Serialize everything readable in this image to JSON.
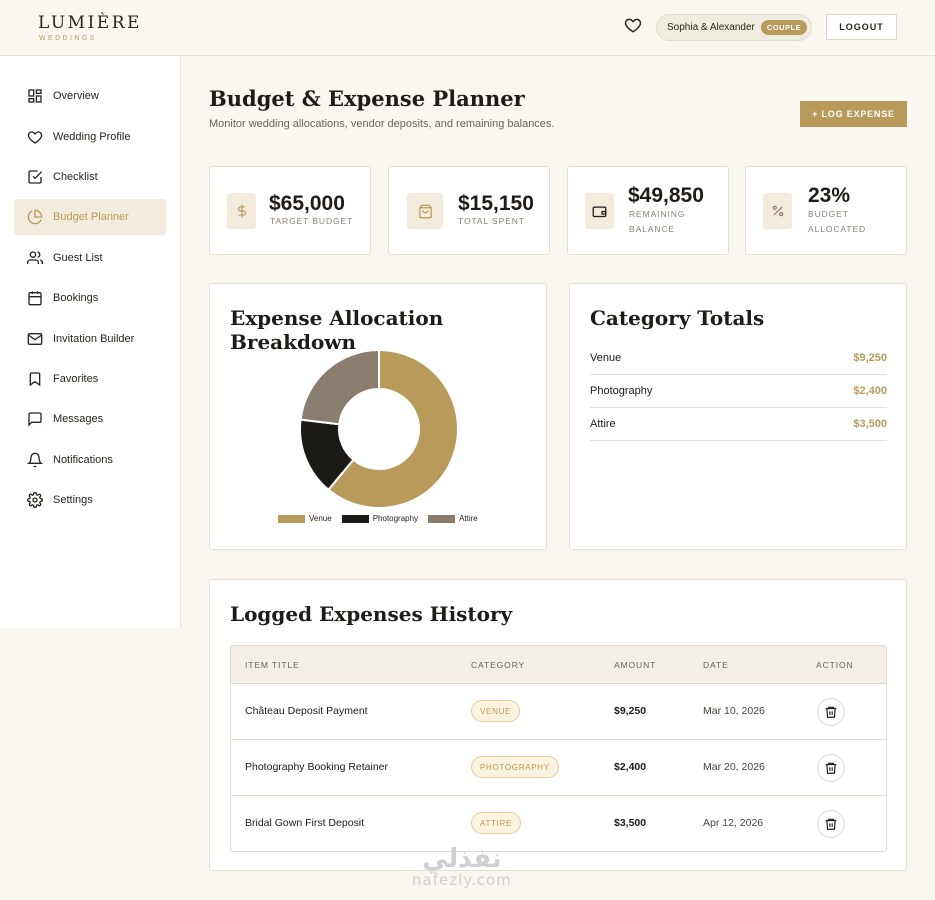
{
  "brand": {
    "name": "LUMIÈRE",
    "tagline": "WEDDINGS"
  },
  "header": {
    "user_name": "Sophia & Alexander",
    "role_badge": "COUPLE",
    "logout_label": "LOGOUT",
    "icons": {
      "favorites": "heart-icon"
    }
  },
  "sidebar": {
    "items": [
      {
        "label": "Overview",
        "icon": "grid-icon"
      },
      {
        "label": "Wedding Profile",
        "icon": "heart-icon"
      },
      {
        "label": "Checklist",
        "icon": "checkbox-icon"
      },
      {
        "label": "Budget Planner",
        "icon": "pie-chart-icon",
        "active": true
      },
      {
        "label": "Guest List",
        "icon": "users-icon"
      },
      {
        "label": "Bookings",
        "icon": "calendar-icon"
      },
      {
        "label": "Invitation Builder",
        "icon": "mail-icon"
      },
      {
        "label": "Favorites",
        "icon": "bookmark-icon"
      },
      {
        "label": "Messages",
        "icon": "message-icon"
      },
      {
        "label": "Notifications",
        "icon": "bell-icon"
      },
      {
        "label": "Settings",
        "icon": "gear-icon"
      }
    ]
  },
  "page": {
    "title": "Budget & Expense Planner",
    "subtitle": "Monitor wedding allocations, vendor deposits, and remaining balances.",
    "log_expense_label": "+ LOG EXPENSE"
  },
  "stats": [
    {
      "value": "$65,000",
      "label_lines": [
        "TARGET BUDGET"
      ],
      "icon": "dollar-icon"
    },
    {
      "value": "$15,150",
      "label_lines": [
        "TOTAL SPENT"
      ],
      "icon": "shopping-bag-icon"
    },
    {
      "value": "$49,850",
      "label_lines": [
        "REMAINING",
        "BALANCE"
      ],
      "icon": "wallet-icon"
    },
    {
      "value": "23%",
      "label_lines": [
        "BUDGET",
        "ALLOCATED"
      ],
      "icon": "percent-icon"
    }
  ],
  "allocation": {
    "title": "Expense Allocation Breakdown"
  },
  "chart_data": {
    "type": "pie",
    "donut": true,
    "categories": [
      "Venue",
      "Photography",
      "Attire"
    ],
    "values": [
      9250,
      2400,
      3500
    ],
    "colors": [
      "#b89a5a",
      "#1c1a17",
      "#8b7d6e"
    ],
    "legend_position": "bottom"
  },
  "category_totals": {
    "title": "Category Totals",
    "rows": [
      {
        "name": "Venue",
        "amount": "$9,250"
      },
      {
        "name": "Photography",
        "amount": "$2,400"
      },
      {
        "name": "Attire",
        "amount": "$3,500"
      }
    ]
  },
  "history": {
    "title": "Logged Expenses History",
    "columns": [
      "ITEM TITLE",
      "CATEGORY",
      "AMOUNT",
      "DATE",
      "ACTION"
    ],
    "rows": [
      {
        "title": "Château Deposit Payment",
        "category": "VENUE",
        "amount": "$9,250",
        "date": "Mar 10, 2026"
      },
      {
        "title": "Photography Booking Retainer",
        "category": "PHOTOGRAPHY",
        "amount": "$2,400",
        "date": "Mar 20, 2026"
      },
      {
        "title": "Bridal Gown First Deposit",
        "category": "ATTIRE",
        "amount": "$3,500",
        "date": "Apr 12, 2026"
      }
    ]
  },
  "watermark": {
    "arabic": "نفذلي",
    "latin": "nafezly.com"
  },
  "colors": {
    "accent": "#b89a5a",
    "background": "#faf7f1",
    "dark": "#1c1a17",
    "taupe": "#8b7d6e"
  }
}
